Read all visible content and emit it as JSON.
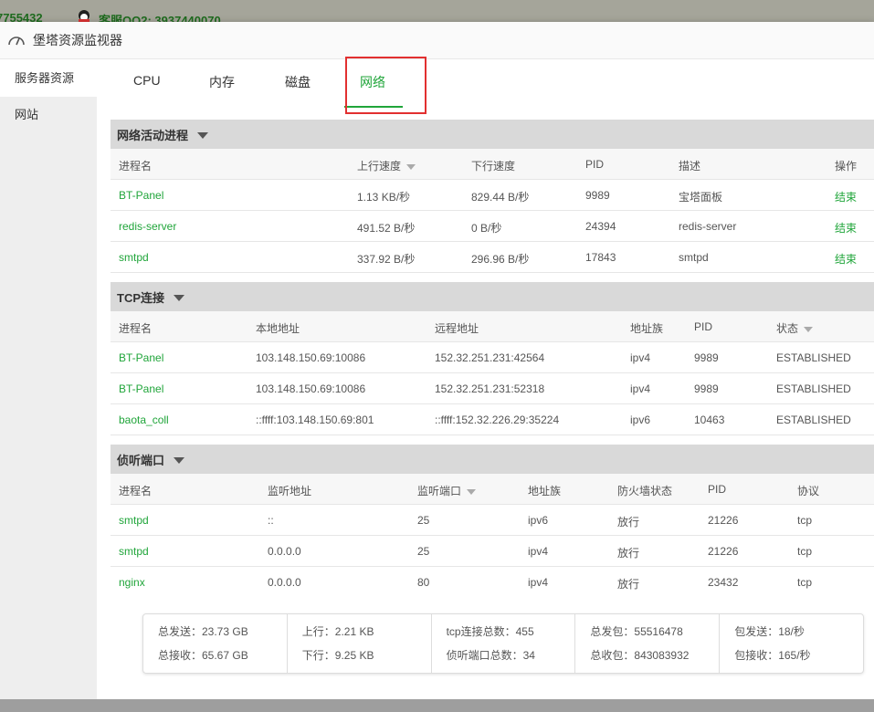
{
  "background": {
    "text1": "7755432",
    "text2": "客服QQ2: 3937440070"
  },
  "window": {
    "title": "堡塔资源监视器"
  },
  "sidebar": {
    "items": [
      {
        "label": "服务器资源"
      },
      {
        "label": "网站"
      }
    ]
  },
  "tabs": [
    {
      "label": "CPU"
    },
    {
      "label": "内存"
    },
    {
      "label": "磁盘"
    },
    {
      "label": "网络"
    }
  ],
  "net_process": {
    "title": "网络活动进程",
    "headers": [
      "进程名",
      "上行速度",
      "下行速度",
      "PID",
      "描述",
      "操作"
    ],
    "rows": [
      {
        "name": "BT-Panel",
        "up": "1.13 KB/秒",
        "down": "829.44 B/秒",
        "pid": "9989",
        "desc": "宝塔面板",
        "action": "结束"
      },
      {
        "name": "redis-server",
        "up": "491.52 B/秒",
        "down": "0 B/秒",
        "pid": "24394",
        "desc": "redis-server",
        "action": "结束"
      },
      {
        "name": "smtpd",
        "up": "337.92 B/秒",
        "down": "296.96 B/秒",
        "pid": "17843",
        "desc": "smtpd",
        "action": "结束"
      }
    ]
  },
  "tcp": {
    "title": "TCP连接",
    "headers": [
      "进程名",
      "本地地址",
      "远程地址",
      "地址族",
      "PID",
      "状态"
    ],
    "rows": [
      {
        "name": "BT-Panel",
        "local": "103.148.150.69:10086",
        "remote": "152.32.251.231:42564",
        "family": "ipv4",
        "pid": "9989",
        "state": "ESTABLISHED"
      },
      {
        "name": "BT-Panel",
        "local": "103.148.150.69:10086",
        "remote": "152.32.251.231:52318",
        "family": "ipv4",
        "pid": "9989",
        "state": "ESTABLISHED"
      },
      {
        "name": "baota_coll",
        "local": "::ffff:103.148.150.69:801",
        "remote": "::ffff:152.32.226.29:35224",
        "family": "ipv6",
        "pid": "10463",
        "state": "ESTABLISHED"
      }
    ]
  },
  "listen": {
    "title": "侦听端口",
    "headers": [
      "进程名",
      "监听地址",
      "监听端口",
      "地址族",
      "防火墙状态",
      "PID",
      "协议"
    ],
    "rows": [
      {
        "name": "smtpd",
        "addr": "::",
        "port": "25",
        "family": "ipv6",
        "fw": "放行",
        "pid": "21226",
        "proto": "tcp"
      },
      {
        "name": "smtpd",
        "addr": "0.0.0.0",
        "port": "25",
        "family": "ipv4",
        "fw": "放行",
        "pid": "21226",
        "proto": "tcp"
      },
      {
        "name": "nginx",
        "addr": "0.0.0.0",
        "port": "80",
        "family": "ipv4",
        "fw": "放行",
        "pid": "23432",
        "proto": "tcp"
      }
    ]
  },
  "stats": {
    "total_sent": "总发送：23.73 GB",
    "total_recv": "总接收：65.67 GB",
    "up": "上行：2.21 KB",
    "down": "下行：9.25 KB",
    "tcp_total": "tcp连接总数：455",
    "listen_total": "侦听端口总数：34",
    "pkt_sent_total": "总发包：55516478",
    "pkt_recv_total": "总收包：843083932",
    "pkt_sent_rate": "包发送：18/秒",
    "pkt_recv_rate": "包接收：165/秒"
  },
  "colors": {
    "accent": "#20a53a",
    "highlight": "#e23030"
  }
}
